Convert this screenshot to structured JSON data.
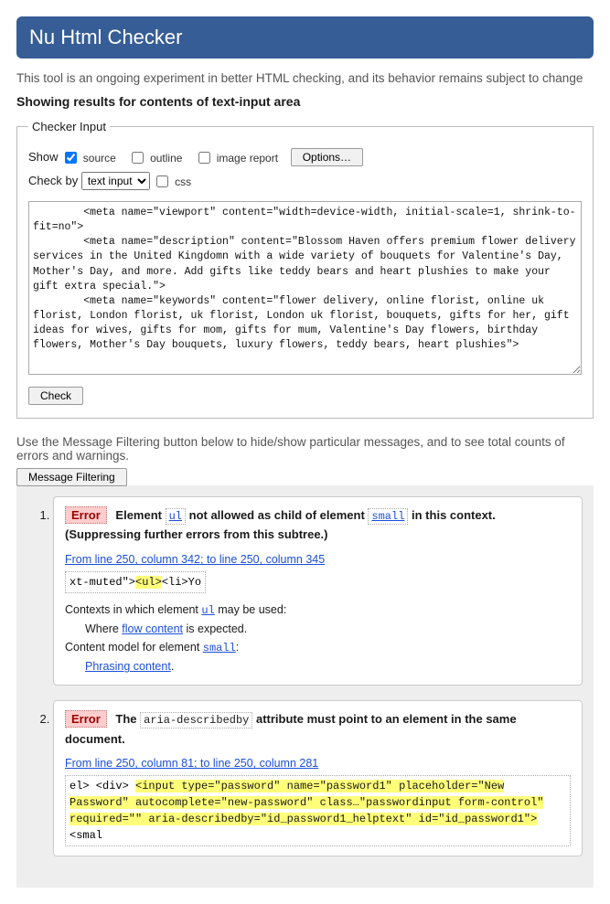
{
  "banner": {
    "title": "Nu Html Checker"
  },
  "subnote": "This tool is an ongoing experiment in better HTML checking, and its behavior remains subject to change",
  "results_for": "Showing results for contents of text-input area",
  "checker": {
    "legend": "Checker Input",
    "show_label": "Show",
    "cb_source": "source",
    "cb_outline": "outline",
    "cb_image_report": "image report",
    "options_btn": "Options…",
    "checkby_label": "Check by",
    "checkby_value": "text input",
    "css_label": "css",
    "textarea_value": "        <meta name=\"viewport\" content=\"width=device-width, initial-scale=1, shrink-to-fit=no\">\n        <meta name=\"description\" content=\"Blossom Haven offers premium flower delivery services in the United Kingdomn with a wide variety of bouquets for Valentine's Day, Mother's Day, and more. Add gifts like teddy bears and heart plushies to make your gift extra special.\">\n        <meta name=\"keywords\" content=\"flower delivery, online florist, online uk florist, London florist, uk florist, London uk florist, bouquets, gifts for her, gift ideas for wives, gifts for mom, gifts for mum, Valentine's Day flowers, birthday flowers, Mother's Day bouquets, luxury flowers, teddy bears, heart plushies\">\n\n",
    "check_btn": "Check"
  },
  "filter": {
    "note": "Use the Message Filtering button below to hide/show particular messages, and to see total counts of errors and warnings.",
    "btn": "Message Filtering"
  },
  "msgs": [
    {
      "tag": "Error",
      "text_parts": {
        "p1": "Element ",
        "code1": "ul",
        "p2": " not allowed as child of element ",
        "code2": "small",
        "p3": " in this context. (Suppressing further errors from this subtree.)"
      },
      "location": "From line 250, column 342; to line 250, column 345",
      "extract_pre": "xt-muted\">",
      "extract_hl": "<ul>",
      "extract_post": "<li>Yo",
      "details": {
        "l1a": "Contexts in which element ",
        "l1code": "ul",
        "l1b": " may be used:",
        "l2a": "Where ",
        "l2link": "flow content",
        "l2b": " is expected.",
        "l3a": "Content model for element ",
        "l3code": "small",
        "l3b": ":",
        "l4link": "Phrasing content",
        "l4b": "."
      }
    },
    {
      "tag": "Error",
      "text_parts": {
        "p1": "The ",
        "code1": "aria-describedby",
        "p2": " attribute must point to an element in the same document."
      },
      "location": "From line 250, column 81; to line 250, column 281",
      "extract_pre": "el> <div> ",
      "extract_hl": "<input type=\"password\" name=\"password1\" placeholder=\"New Password\" autocomplete=\"new-password\" class…\"passwordinput form-control\" required=\"\" aria-describedby=\"id_password1_helptext\" id=\"id_password1\">",
      "extract_post": " <smal"
    }
  ]
}
